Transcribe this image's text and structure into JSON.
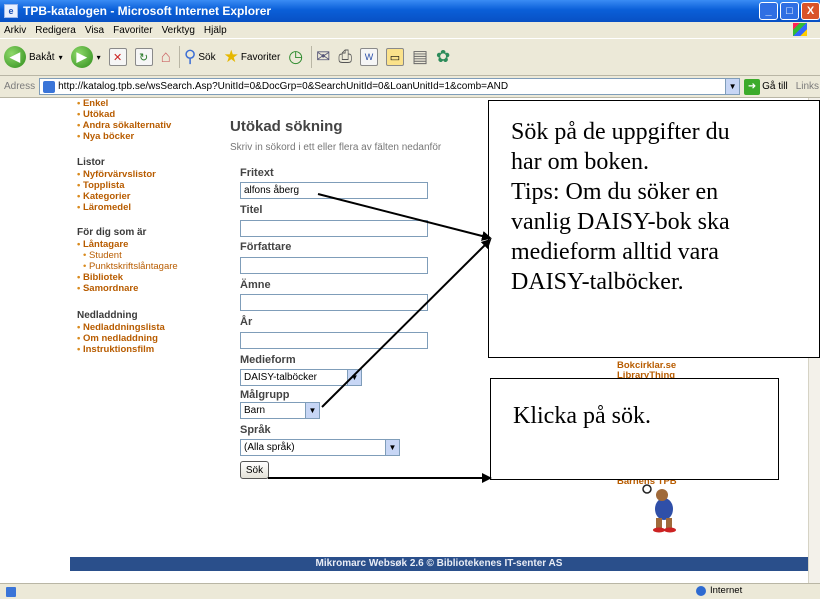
{
  "window": {
    "title": "TPB-katalogen - Microsoft Internet Explorer",
    "controls": [
      "_",
      "□",
      "X"
    ]
  },
  "menu": [
    "Arkiv",
    "Redigera",
    "Visa",
    "Favoriter",
    "Verktyg",
    "Hjälp"
  ],
  "toolbar": {
    "back": "Bakåt",
    "search": "Sök",
    "favorites": "Favoriter"
  },
  "address": {
    "label": "Adress",
    "url": "http://katalog.tpb.se/wsSearch.Asp?UnitId=0&DocGrp=0&SearchUnitId=0&LoanUnitId=1&comb=AND",
    "go": "Gå till",
    "links": "Links"
  },
  "nav": {
    "top_items": [
      "Enkel",
      "Utökad",
      "Andra sökalternativ",
      "Nya böcker"
    ],
    "lists_heading": "Listor",
    "lists": [
      "Nyförvärvslistor",
      "Topplista",
      "Kategorier",
      "Läromedel"
    ],
    "for_you_heading": "För dig som är",
    "for_you": [
      "Låntagare"
    ],
    "for_you_sub": [
      "Student",
      "Punktskriftslåntagare"
    ],
    "for_you_more": [
      "Bibliotek",
      "Samordnare"
    ],
    "download_heading": "Nedladdning",
    "download": [
      "Nedladdningslista",
      "Om nedladdning",
      "Instruktionsfilm"
    ]
  },
  "form": {
    "title": "Utökad sökning",
    "intro": "Skriv in sökord i ett eller flera av fälten nedanför",
    "fritext_label": "Fritext",
    "fritext_value": "alfons åberg",
    "titel_label": "Titel",
    "forfattare_label": "Författare",
    "amne_label": "Ämne",
    "ar_label": "År",
    "medieform_label": "Medieform",
    "medieform_value": "DAISY-talböcker",
    "malgrupp_label": "Målgrupp",
    "malgrupp_value": "Barn",
    "sprak_label": "Språk",
    "sprak_value": "(Alla språk)",
    "search_button": "Sök"
  },
  "right_links": [
    "Bokcirklar.se",
    "LibraryThing",
    "Barnens TPB"
  ],
  "footer": "Mikromarc Websøk 2.6 © Bibliotekenes IT-senter AS",
  "status": {
    "zone": "Internet"
  },
  "callouts": {
    "first": [
      "Sök på de uppgifter du",
      "har om boken.",
      "Tips: Om du söker en",
      "vanlig DAISY-bok ska",
      "medieform alltid vara",
      "DAISY-talböcker."
    ],
    "second": "Klicka på sök."
  }
}
